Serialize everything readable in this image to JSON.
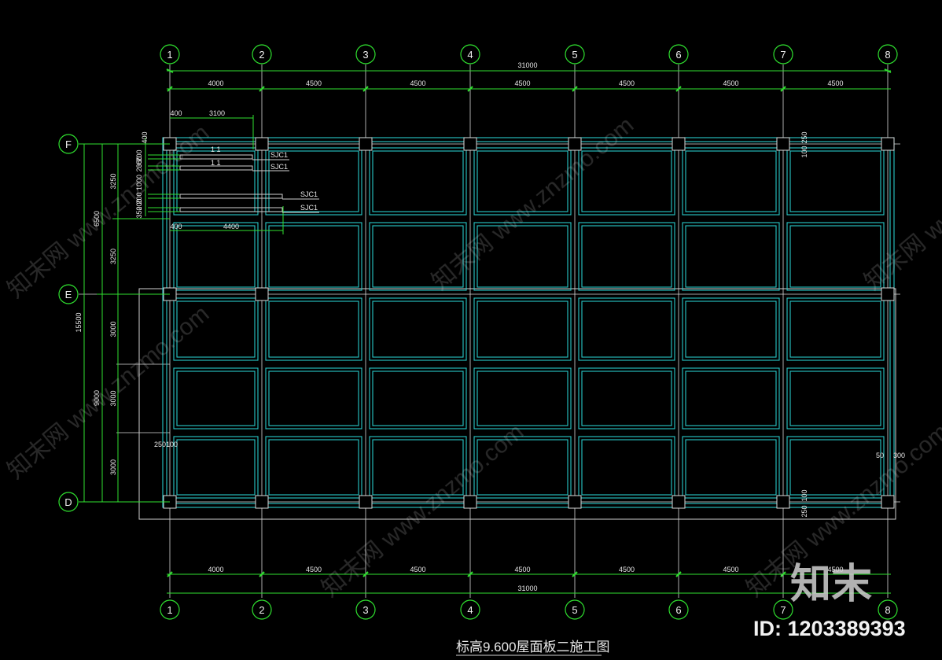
{
  "drawing": {
    "title": "标高9.600屋面板二施工图"
  },
  "grid": {
    "cols": [
      "1",
      "2",
      "3",
      "4",
      "5",
      "6",
      "7",
      "8"
    ],
    "rows": [
      "F",
      "E",
      "D"
    ]
  },
  "dimensions": {
    "top_total": "31000",
    "bottom_total": "31000",
    "spans": [
      "4000",
      "4500",
      "4500",
      "4500",
      "4500",
      "4500",
      "4500"
    ],
    "left_total": "15500",
    "left_f_e": "6500",
    "left_e_d": "9000",
    "left_sub": [
      "3250",
      "3250",
      "3000",
      "3000",
      "3000"
    ],
    "detail_top": [
      "400",
      "3100"
    ],
    "detail_bottom": [
      "400",
      "4400"
    ],
    "detail_vertical": [
      "400",
      "350",
      "200",
      "200",
      "1000",
      "200",
      "200",
      "350"
    ],
    "right_top": [
      "250",
      "100"
    ],
    "right_bottom": [
      "100",
      "250"
    ],
    "left_offset": "250100",
    "right_offset": [
      "50",
      "300"
    ]
  },
  "labels": {
    "beam_labels": [
      "SJC1",
      "SJC1",
      "SJC1",
      "SJC1"
    ],
    "section_marks": [
      "1 1",
      "1 1"
    ]
  },
  "watermark": {
    "brand": "知末",
    "repeat_text": "知末网 www.znzmo.com",
    "id_text": "ID: 1203389393"
  }
}
